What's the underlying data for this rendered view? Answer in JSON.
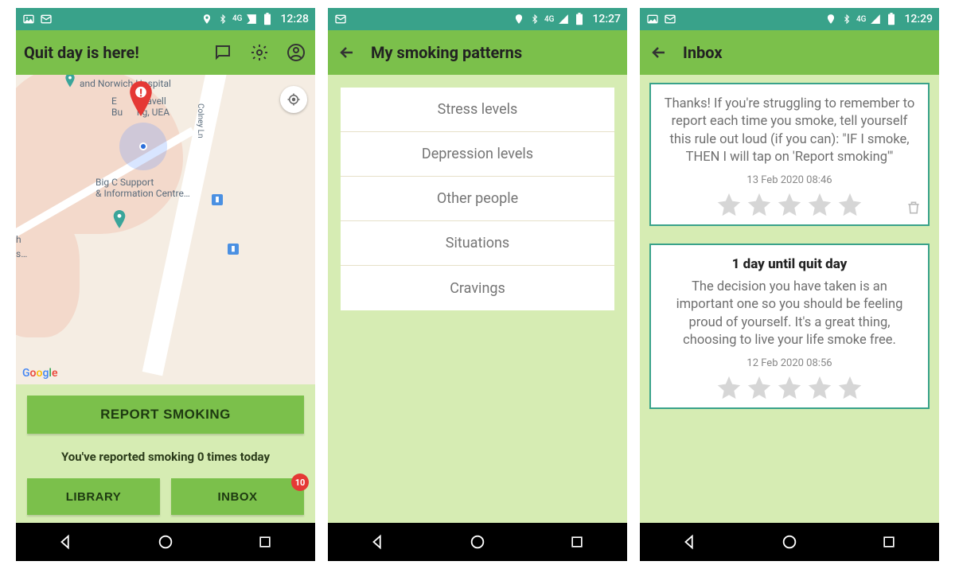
{
  "screens": [
    {
      "status": {
        "time": "12:28",
        "network": "4G"
      },
      "appbar": {
        "title": "Quit day is here!",
        "actions": [
          "chat",
          "settings",
          "account"
        ]
      },
      "map": {
        "labels": {
          "hospital": "and Norwich Hospital",
          "building": "E          Cavell\nBu      ng, UEA",
          "support": "Big C Support\n& Information Centre…",
          "road": "Colney Ln",
          "edge1": "h",
          "edge2": "s…"
        }
      },
      "panel": {
        "report_btn": "REPORT SMOKING",
        "report_text": "You've reported smoking 0 times today",
        "library_btn": "LIBRARY",
        "inbox_btn": "INBOX",
        "inbox_badge": "10"
      }
    },
    {
      "status": {
        "time": "12:27",
        "network": "4G"
      },
      "appbar": {
        "title": "My smoking patterns"
      },
      "list": [
        "Stress levels",
        "Depression levels",
        "Other people",
        "Situations",
        "Cravings"
      ]
    },
    {
      "status": {
        "time": "12:29",
        "network": "4G"
      },
      "appbar": {
        "title": "Inbox"
      },
      "messages": [
        {
          "title": "",
          "body": "Thanks! If you're struggling to remember to report each time you smoke, tell yourself this rule out loud (if you can): \"IF I smoke, THEN I will tap on 'Report smoking'\"",
          "date": "13 Feb 2020 08:46",
          "rating": 0
        },
        {
          "title": "1 day until quit day",
          "body": "The decision you have taken is an important one so you should be feeling proud of yourself. It's a great thing, choosing to live your life smoke free.",
          "date": "12 Feb 2020 08:56",
          "rating": 0
        }
      ]
    }
  ]
}
